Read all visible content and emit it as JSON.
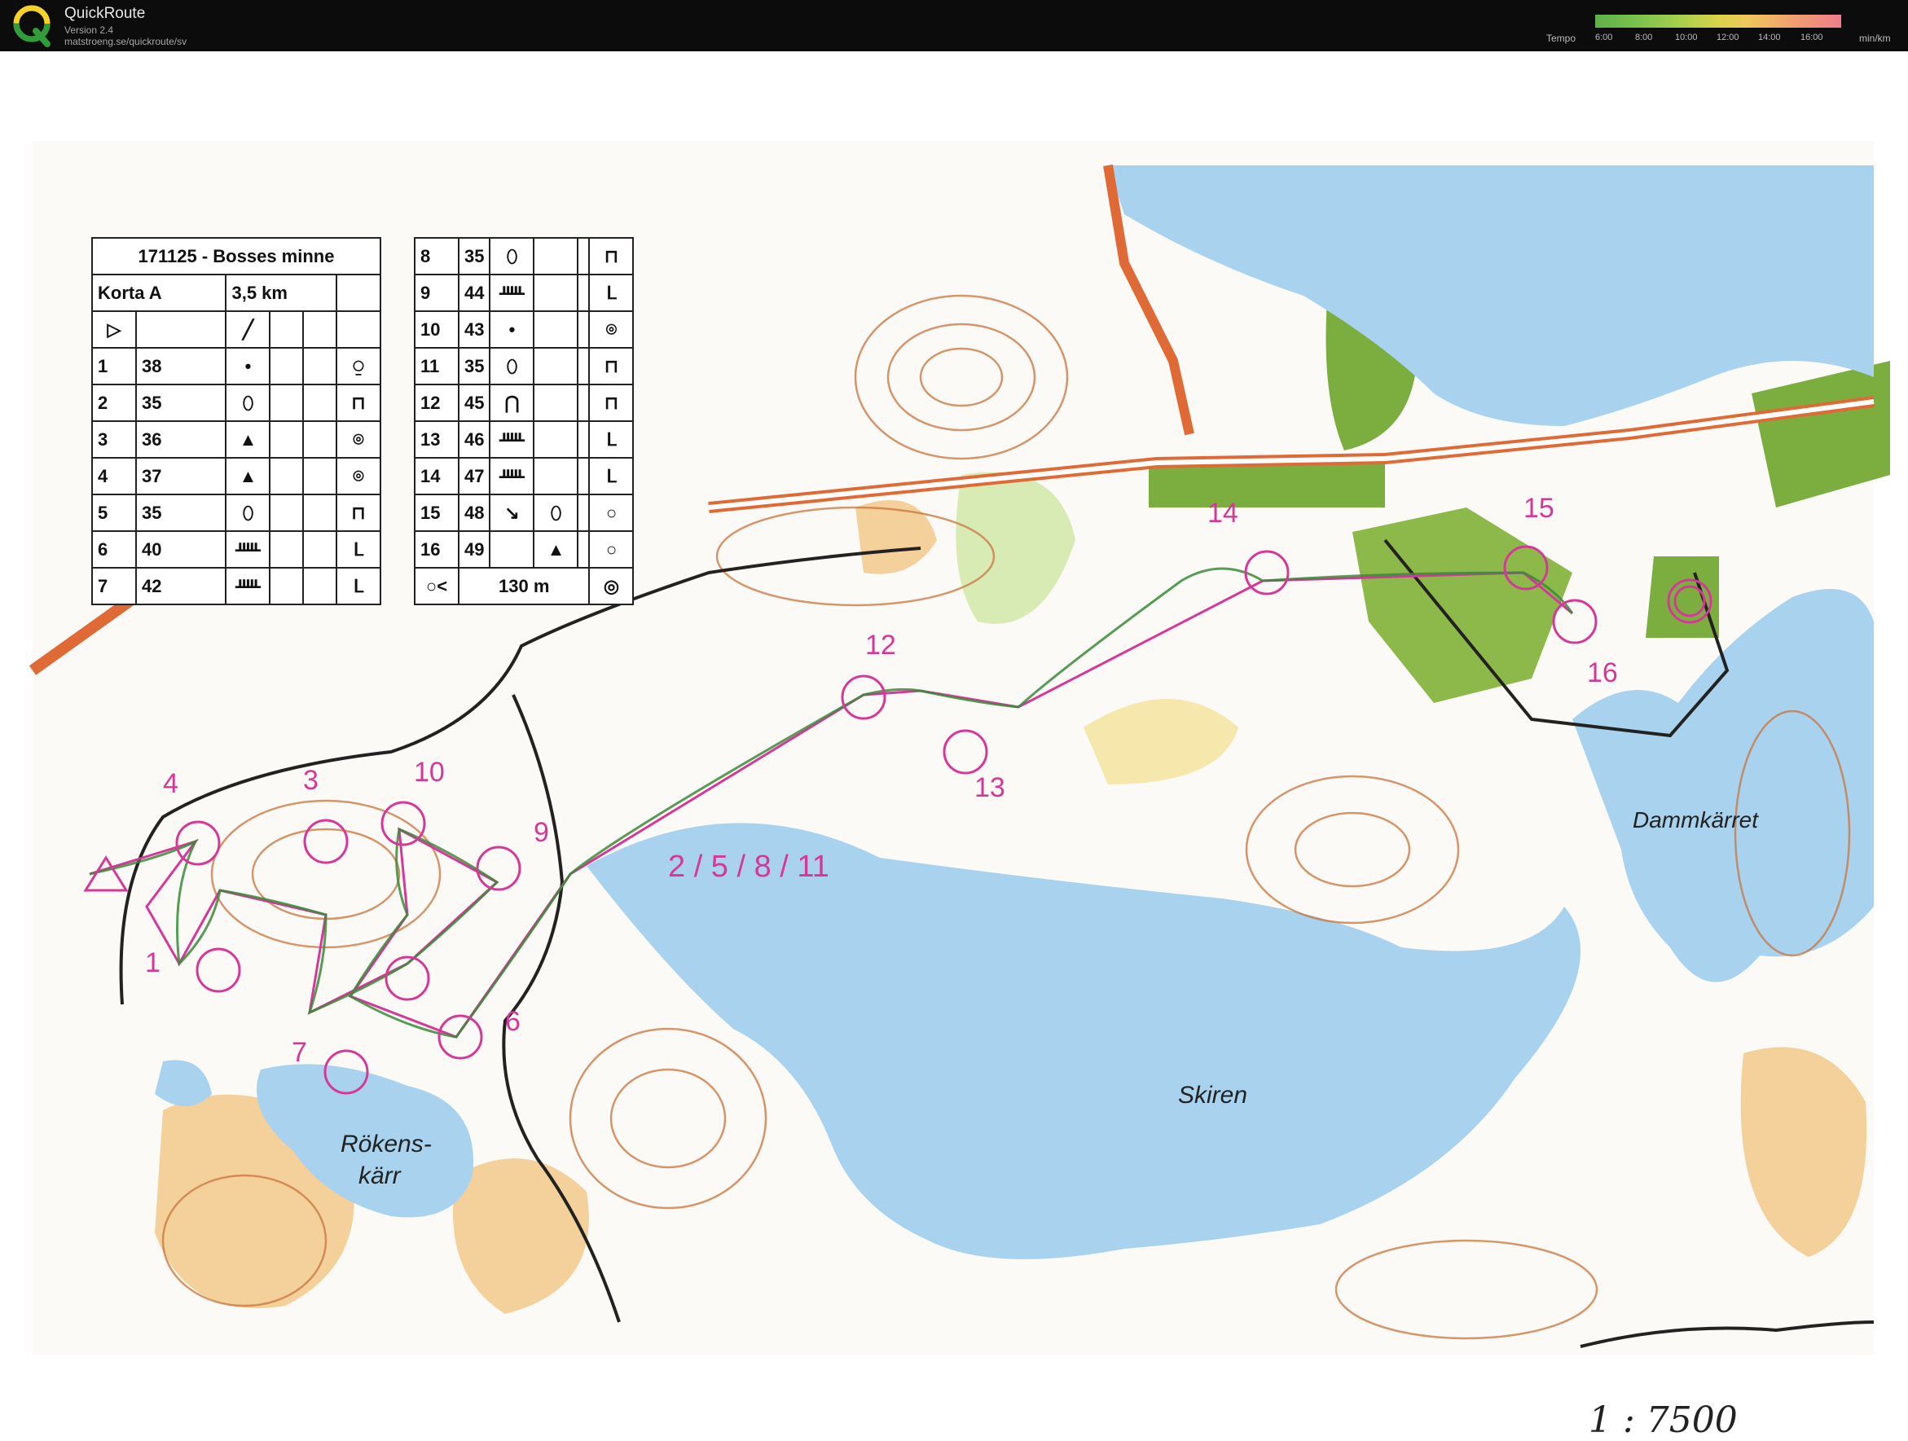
{
  "app": {
    "title": "QuickRoute",
    "version": "Version 2.4",
    "url": "matstroeng.se/quickroute/sv"
  },
  "tempo": {
    "label": "Tempo",
    "ticks": [
      "6:00",
      "8:00",
      "10:00",
      "12:00",
      "14:00",
      "16:00"
    ],
    "unit": "min/km",
    "gradient_colors": [
      "#5fb04a",
      "#a9d04c",
      "#d9d24c",
      "#efc85a",
      "#f0a070",
      "#f07c8c"
    ]
  },
  "course": {
    "title": "171125 - Bosses minne",
    "class": "Korta A",
    "length": "3,5 km",
    "controls_left": [
      {
        "n": "1",
        "code": "38"
      },
      {
        "n": "2",
        "code": "35"
      },
      {
        "n": "3",
        "code": "36"
      },
      {
        "n": "4",
        "code": "37"
      },
      {
        "n": "5",
        "code": "35"
      },
      {
        "n": "6",
        "code": "40"
      },
      {
        "n": "7",
        "code": "42"
      }
    ],
    "controls_right": [
      {
        "n": "8",
        "code": "35"
      },
      {
        "n": "9",
        "code": "44"
      },
      {
        "n": "10",
        "code": "43"
      },
      {
        "n": "11",
        "code": "35"
      },
      {
        "n": "12",
        "code": "45"
      },
      {
        "n": "13",
        "code": "46"
      },
      {
        "n": "14",
        "code": "47"
      },
      {
        "n": "15",
        "code": "48"
      },
      {
        "n": "16",
        "code": "49"
      }
    ],
    "finish_distance": "130 m"
  },
  "map": {
    "labels": {
      "lake_main": "Skiren",
      "lake_right": "Dammkärret",
      "lake_left_1": "Rökens-",
      "lake_left_2": "kärr",
      "multi_control": "2 / 5 / 8 / 11"
    },
    "control_numbers": [
      "1",
      "3",
      "4",
      "6",
      "7",
      "9",
      "10",
      "12",
      "13",
      "14",
      "15",
      "16"
    ],
    "scale_note": "1 : 7500",
    "colors": {
      "water": "#a8d2ee",
      "forest_open": "#f2c88a",
      "green": "#7cae3f",
      "contour": "#c9743d",
      "course": "#d6389a",
      "road": "#e06a35",
      "route": "#3a8a3a"
    }
  }
}
